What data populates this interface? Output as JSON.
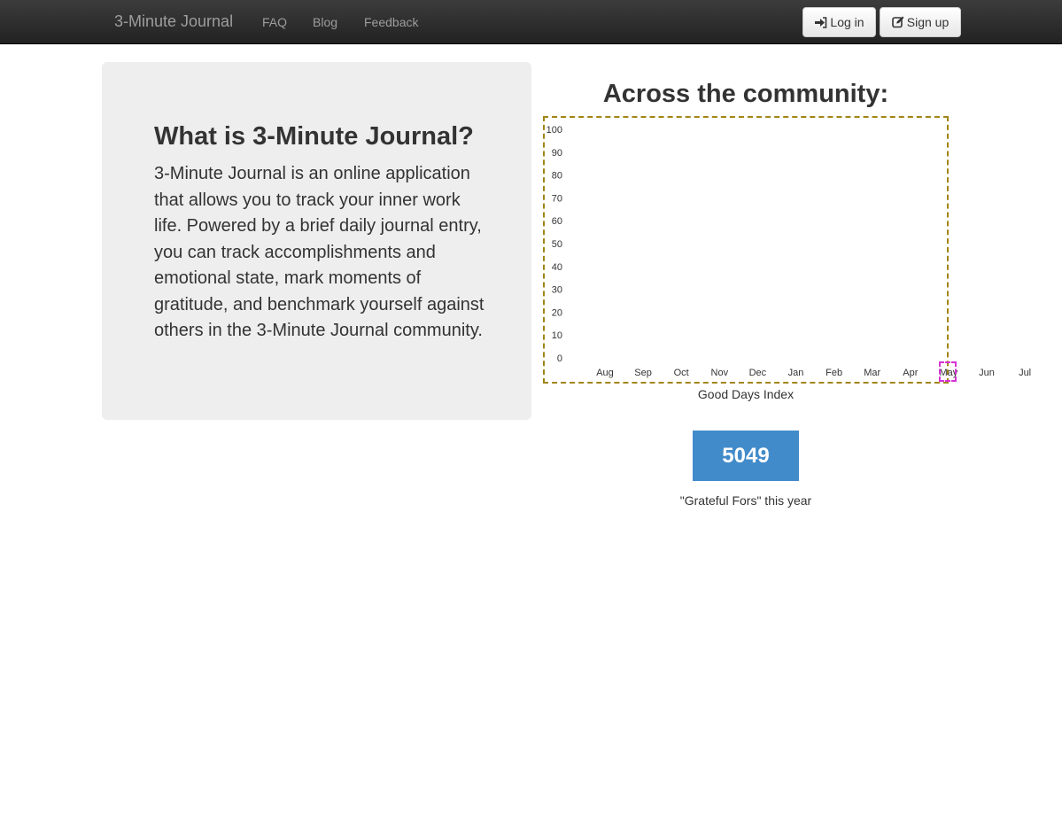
{
  "navbar": {
    "brand": "3-Minute Journal",
    "links": [
      "FAQ",
      "Blog",
      "Feedback"
    ],
    "login_label": "Log in",
    "signup_label": "Sign up",
    "login_icon": "sign-in-icon",
    "signup_icon": "edit-icon"
  },
  "intro": {
    "heading": "What is 3-Minute Journal?",
    "body": "3-Minute Journal is an online application that allows you to track your inner work life. Powered by a brief daily journal entry, you can track accomplishments and emotional state, mark moments of gratitude, and benchmark yourself against others in the 3-Minute Journal community."
  },
  "community": {
    "title": "Across the community:",
    "stat_value": "5049",
    "stat_caption": "\"Grateful Fors\" this year",
    "stat_color": "#428bca"
  },
  "chart_data": {
    "type": "bar",
    "title": "",
    "xlabel": "Good Days Index",
    "ylabel": "",
    "categories": [
      "Aug",
      "Sep",
      "Oct",
      "Nov",
      "Dec",
      "Jan",
      "Feb",
      "Mar",
      "Apr",
      "May",
      "Jun",
      "Jul"
    ],
    "values": [],
    "yticks": [
      0,
      10,
      20,
      30,
      40,
      50,
      60,
      70,
      80,
      90,
      100
    ],
    "ylim": [
      0,
      100
    ],
    "grid": false
  }
}
